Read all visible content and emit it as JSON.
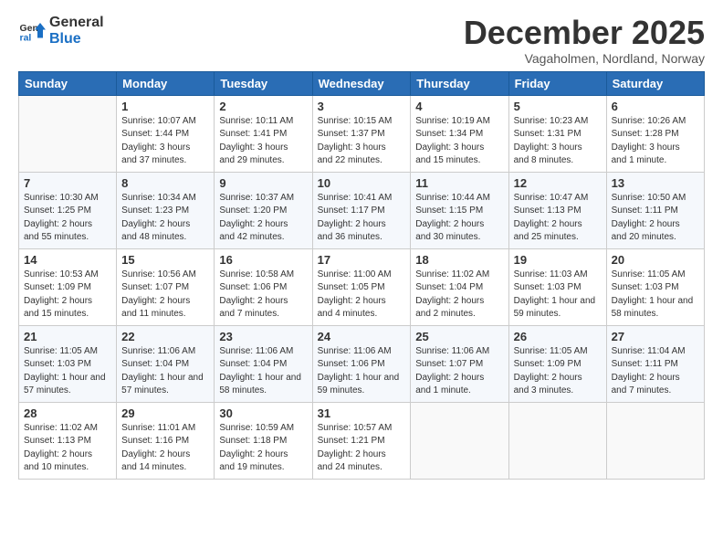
{
  "logo": {
    "general": "General",
    "blue": "Blue"
  },
  "title": "December 2025",
  "subtitle": "Vagaholmen, Nordland, Norway",
  "headers": [
    "Sunday",
    "Monday",
    "Tuesday",
    "Wednesday",
    "Thursday",
    "Friday",
    "Saturday"
  ],
  "weeks": [
    [
      {
        "day": "",
        "info": ""
      },
      {
        "day": "1",
        "info": "Sunrise: 10:07 AM\nSunset: 1:44 PM\nDaylight: 3 hours\nand 37 minutes."
      },
      {
        "day": "2",
        "info": "Sunrise: 10:11 AM\nSunset: 1:41 PM\nDaylight: 3 hours\nand 29 minutes."
      },
      {
        "day": "3",
        "info": "Sunrise: 10:15 AM\nSunset: 1:37 PM\nDaylight: 3 hours\nand 22 minutes."
      },
      {
        "day": "4",
        "info": "Sunrise: 10:19 AM\nSunset: 1:34 PM\nDaylight: 3 hours\nand 15 minutes."
      },
      {
        "day": "5",
        "info": "Sunrise: 10:23 AM\nSunset: 1:31 PM\nDaylight: 3 hours\nand 8 minutes."
      },
      {
        "day": "6",
        "info": "Sunrise: 10:26 AM\nSunset: 1:28 PM\nDaylight: 3 hours\nand 1 minute."
      }
    ],
    [
      {
        "day": "7",
        "info": "Sunrise: 10:30 AM\nSunset: 1:25 PM\nDaylight: 2 hours\nand 55 minutes."
      },
      {
        "day": "8",
        "info": "Sunrise: 10:34 AM\nSunset: 1:23 PM\nDaylight: 2 hours\nand 48 minutes."
      },
      {
        "day": "9",
        "info": "Sunrise: 10:37 AM\nSunset: 1:20 PM\nDaylight: 2 hours\nand 42 minutes."
      },
      {
        "day": "10",
        "info": "Sunrise: 10:41 AM\nSunset: 1:17 PM\nDaylight: 2 hours\nand 36 minutes."
      },
      {
        "day": "11",
        "info": "Sunrise: 10:44 AM\nSunset: 1:15 PM\nDaylight: 2 hours\nand 30 minutes."
      },
      {
        "day": "12",
        "info": "Sunrise: 10:47 AM\nSunset: 1:13 PM\nDaylight: 2 hours\nand 25 minutes."
      },
      {
        "day": "13",
        "info": "Sunrise: 10:50 AM\nSunset: 1:11 PM\nDaylight: 2 hours\nand 20 minutes."
      }
    ],
    [
      {
        "day": "14",
        "info": "Sunrise: 10:53 AM\nSunset: 1:09 PM\nDaylight: 2 hours\nand 15 minutes."
      },
      {
        "day": "15",
        "info": "Sunrise: 10:56 AM\nSunset: 1:07 PM\nDaylight: 2 hours\nand 11 minutes."
      },
      {
        "day": "16",
        "info": "Sunrise: 10:58 AM\nSunset: 1:06 PM\nDaylight: 2 hours\nand 7 minutes."
      },
      {
        "day": "17",
        "info": "Sunrise: 11:00 AM\nSunset: 1:05 PM\nDaylight: 2 hours\nand 4 minutes."
      },
      {
        "day": "18",
        "info": "Sunrise: 11:02 AM\nSunset: 1:04 PM\nDaylight: 2 hours\nand 2 minutes."
      },
      {
        "day": "19",
        "info": "Sunrise: 11:03 AM\nSunset: 1:03 PM\nDaylight: 1 hour and\n59 minutes."
      },
      {
        "day": "20",
        "info": "Sunrise: 11:05 AM\nSunset: 1:03 PM\nDaylight: 1 hour and\n58 minutes."
      }
    ],
    [
      {
        "day": "21",
        "info": "Sunrise: 11:05 AM\nSunset: 1:03 PM\nDaylight: 1 hour and\n57 minutes."
      },
      {
        "day": "22",
        "info": "Sunrise: 11:06 AM\nSunset: 1:04 PM\nDaylight: 1 hour and\n57 minutes."
      },
      {
        "day": "23",
        "info": "Sunrise: 11:06 AM\nSunset: 1:04 PM\nDaylight: 1 hour and\n58 minutes."
      },
      {
        "day": "24",
        "info": "Sunrise: 11:06 AM\nSunset: 1:06 PM\nDaylight: 1 hour and\n59 minutes."
      },
      {
        "day": "25",
        "info": "Sunrise: 11:06 AM\nSunset: 1:07 PM\nDaylight: 2 hours\nand 1 minute."
      },
      {
        "day": "26",
        "info": "Sunrise: 11:05 AM\nSunset: 1:09 PM\nDaylight: 2 hours\nand 3 minutes."
      },
      {
        "day": "27",
        "info": "Sunrise: 11:04 AM\nSunset: 1:11 PM\nDaylight: 2 hours\nand 7 minutes."
      }
    ],
    [
      {
        "day": "28",
        "info": "Sunrise: 11:02 AM\nSunset: 1:13 PM\nDaylight: 2 hours\nand 10 minutes."
      },
      {
        "day": "29",
        "info": "Sunrise: 11:01 AM\nSunset: 1:16 PM\nDaylight: 2 hours\nand 14 minutes."
      },
      {
        "day": "30",
        "info": "Sunrise: 10:59 AM\nSunset: 1:18 PM\nDaylight: 2 hours\nand 19 minutes."
      },
      {
        "day": "31",
        "info": "Sunrise: 10:57 AM\nSunset: 1:21 PM\nDaylight: 2 hours\nand 24 minutes."
      },
      {
        "day": "",
        "info": ""
      },
      {
        "day": "",
        "info": ""
      },
      {
        "day": "",
        "info": ""
      }
    ]
  ]
}
